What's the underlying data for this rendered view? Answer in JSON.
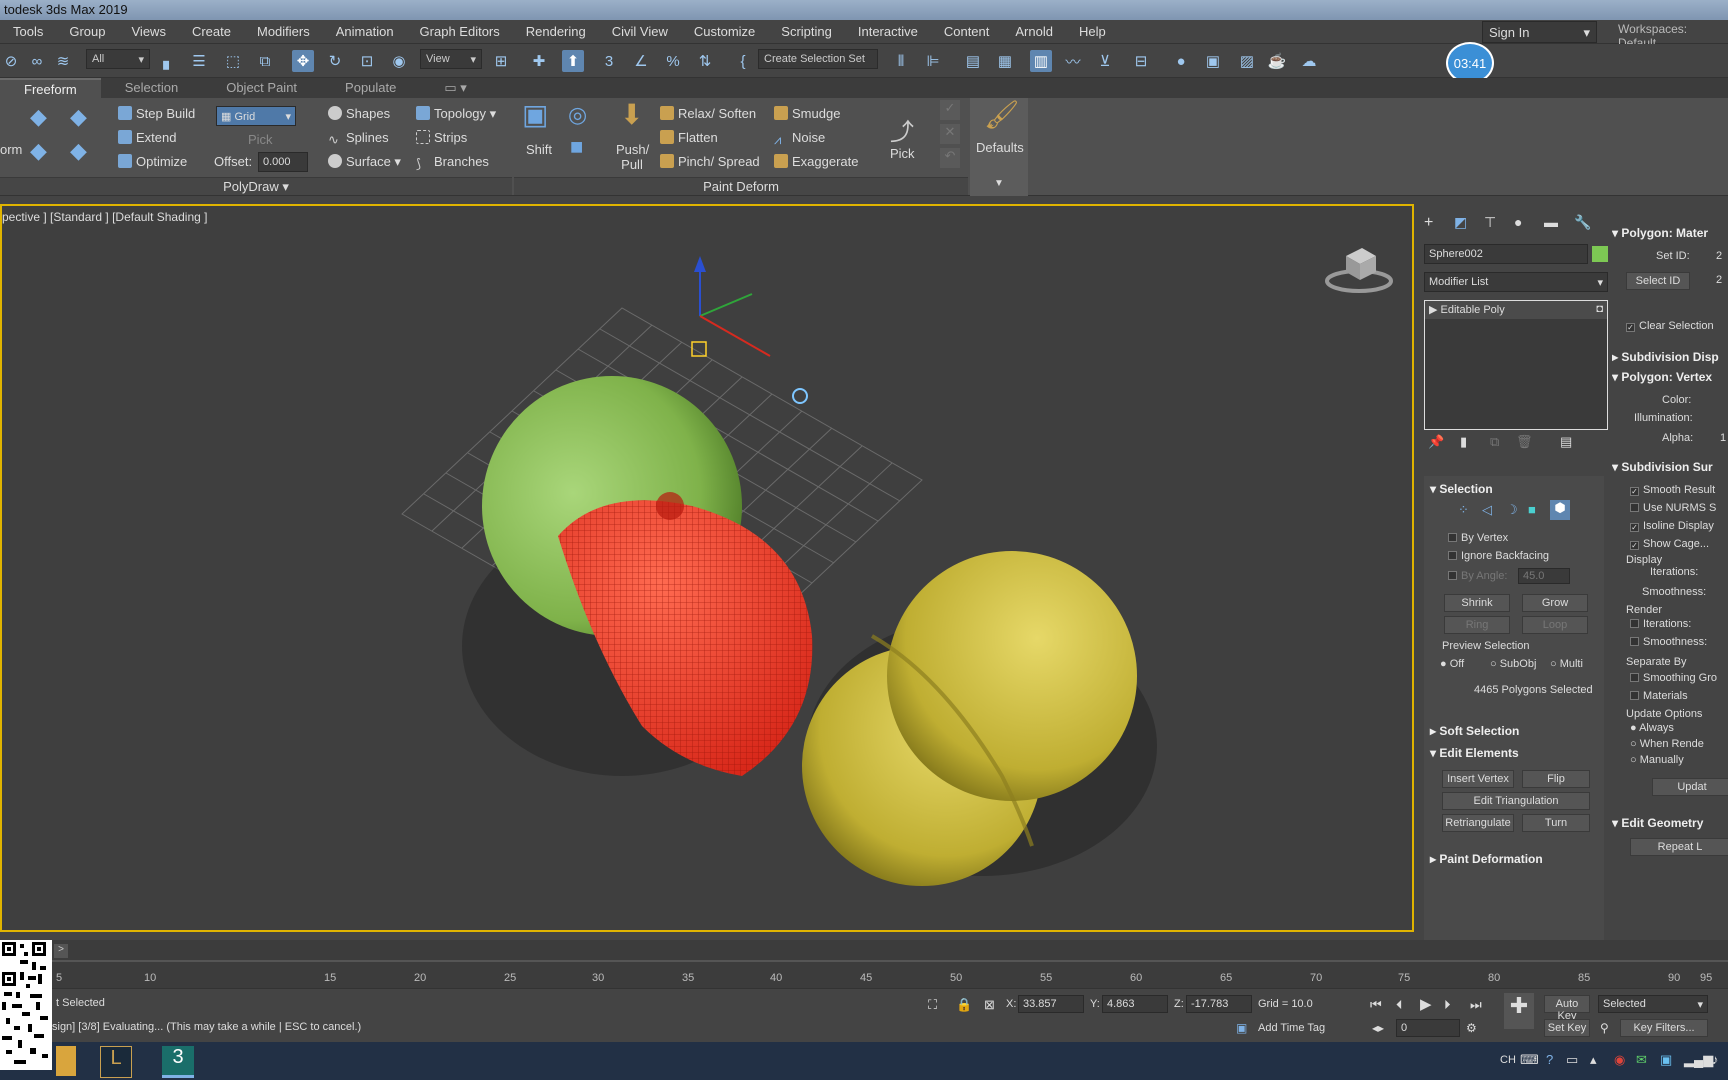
{
  "app": {
    "title": "todesk 3ds Max 2019"
  },
  "menu": [
    "Tools",
    "Group",
    "Views",
    "Create",
    "Modifiers",
    "Animation",
    "Graph Editors",
    "Rendering",
    "Civil View",
    "Customize",
    "Scripting",
    "Interactive",
    "Content",
    "Arnold",
    "Help"
  ],
  "account": {
    "signin": "Sign In",
    "workspaces": "Workspaces:  Default"
  },
  "toolbar": {
    "filter": "All",
    "refcoord": "View",
    "selset": "Create Selection Set"
  },
  "timer": "03:41",
  "ribbon_tabs": [
    "Freeform",
    "Selection",
    "Object Paint",
    "Populate"
  ],
  "ribbon": {
    "form": "orm",
    "step_build": "Step Build",
    "extend": "Extend",
    "optimize": "Optimize",
    "grid": "Grid",
    "pick": "Pick",
    "offset_label": "Offset:",
    "offset_value": "0.000",
    "shapes": "Shapes",
    "splines": "Splines",
    "surface": "Surface",
    "topology": "Topology",
    "strips": "Strips",
    "branches": "Branches",
    "polydraw": "PolyDraw",
    "shift": "Shift",
    "push_pull": "Push/ Pull",
    "relax": "Relax/ Soften",
    "flatten": "Flatten",
    "pinch": "Pinch/ Spread",
    "smudge": "Smudge",
    "noise": "Noise",
    "exaggerate": "Exaggerate",
    "paint_deform": "Paint Deform",
    "pick2": "Pick",
    "defaults": "Defaults"
  },
  "viewport": {
    "label": "pective ] [Standard ] [Default Shading ]"
  },
  "cmd": {
    "object_name": "Sphere002",
    "modifier_list": "Modifier List",
    "stack_item": "Editable Poly",
    "selection": "Selection",
    "by_vertex": "By Vertex",
    "ignore_backfacing": "Ignore Backfacing",
    "by_angle": "By Angle:",
    "by_angle_val": "45.0",
    "shrink": "Shrink",
    "grow": "Grow",
    "ring": "Ring",
    "loop": "Loop",
    "preview_selection": "Preview Selection",
    "off": "Off",
    "subobj": "SubObj",
    "multi": "Multi",
    "selected_count": "4465 Polygons Selected",
    "soft_selection": "Soft Selection",
    "edit_elements": "Edit Elements",
    "insert_vertex": "Insert Vertex",
    "flip": "Flip",
    "edit_triangulation": "Edit Triangulation",
    "retriangulate": "Retriangulate",
    "turn": "Turn",
    "paint_deformation": "Paint Deformation",
    "poly_material": "Polygon: Mater",
    "set_id": "Set ID:",
    "set_id_val": "2",
    "select_id": "Select ID",
    "select_id_val": "2",
    "clear_selection": "Clear Selection",
    "subdiv_disp": "Subdivision Disp",
    "poly_vertex": "Polygon: Vertex",
    "color": "Color:",
    "illumination": "Illumination:",
    "alpha": "Alpha:",
    "alpha_val": "1",
    "subdiv_surf": "Subdivision Sur",
    "smooth_result": "Smooth Result",
    "use_nurms": "Use NURMS S",
    "isoline": "Isoline Display",
    "show_cage": "Show Cage...",
    "display": "Display",
    "iterations": "Iterations:",
    "smoothness": "Smoothness:",
    "render": "Render",
    "iterations2": "Iterations:",
    "smoothness2": "Smoothness:",
    "separate_by": "Separate By",
    "smoothing_groups": "Smoothing Gro",
    "materials": "Materials",
    "update_options": "Update Options",
    "always": "Always",
    "when_render": "When Rende",
    "manually": "Manually",
    "update": "Updat",
    "edit_geometry": "Edit Geometry",
    "repeat_last": "Repeat L"
  },
  "timeline": {
    "ticks": [
      "5",
      "10",
      "15",
      "20",
      "25",
      "30",
      "35",
      "40",
      "45",
      "50",
      "55",
      "60",
      "65",
      "70",
      "75",
      "80",
      "85",
      "90",
      "95"
    ]
  },
  "status": {
    "selected": "t Selected",
    "prompt": "sign] [3/8] Evaluating... (This may take a while | ESC to cancel.)",
    "x_label": "X:",
    "x": "33.857",
    "y_label": "Y:",
    "y": "4.863",
    "z_label": "Z:",
    "z": "-17.783",
    "grid": "Grid = 10.0",
    "add_time_tag": "Add Time Tag",
    "auto_key": "Auto Key",
    "set_key": "Set Key",
    "selected_combo": "Selected",
    "key_filters": "Key Filters...",
    "frame": "0",
    "ime": "CH"
  },
  "colors": {
    "accent": "#e0b400",
    "selection": "#e8392c",
    "green": "#8dc056",
    "yellow": "#c4b534"
  }
}
